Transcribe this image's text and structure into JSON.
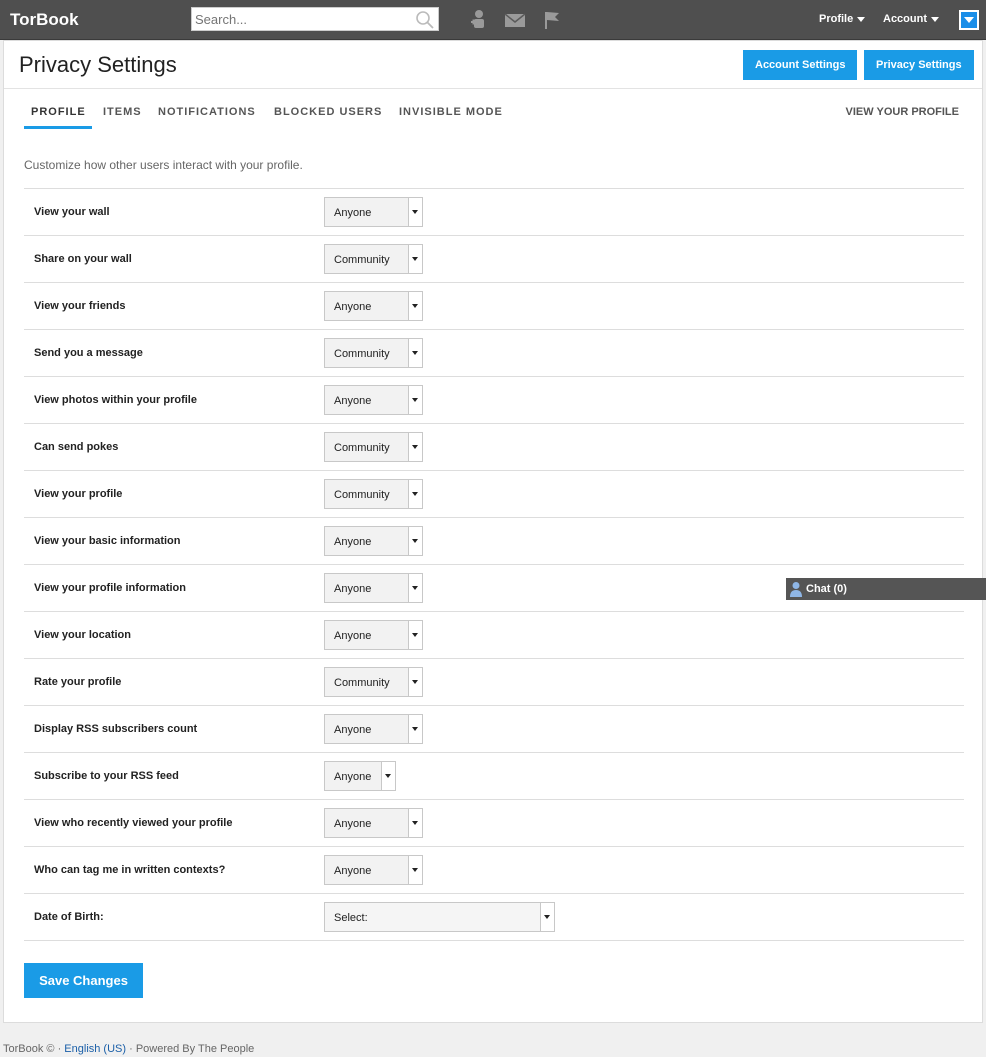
{
  "app": {
    "title": "TorBook"
  },
  "search": {
    "placeholder": "Search..."
  },
  "topnav": {
    "icons": [
      "friend-requests-icon",
      "messages-icon",
      "notifications-flag-icon"
    ],
    "profile_label": "Profile",
    "account_label": "Account"
  },
  "header": {
    "title": "Privacy Settings",
    "account_settings": "Account Settings",
    "privacy_settings": "Privacy Settings"
  },
  "tabs": [
    {
      "label": "PROFILE",
      "active": true
    },
    {
      "label": "ITEMS"
    },
    {
      "label": "NOTIFICATIONS"
    },
    {
      "label": "BLOCKED USERS"
    },
    {
      "label": "INVISIBLE MODE"
    }
  ],
  "view_profile": "VIEW YOUR PROFILE",
  "intro": "Customize how other users interact with your profile.",
  "settings": [
    {
      "label": "View your wall",
      "value": "Anyone"
    },
    {
      "label": "Share on your wall",
      "value": "Community"
    },
    {
      "label": "View your friends",
      "value": "Anyone"
    },
    {
      "label": "Send you a message",
      "value": "Community"
    },
    {
      "label": "View photos within your profile",
      "value": "Anyone"
    },
    {
      "label": "Can send pokes",
      "value": "Community"
    },
    {
      "label": "View your profile",
      "value": "Community"
    },
    {
      "label": "View your basic information",
      "value": "Anyone"
    },
    {
      "label": "View your profile information",
      "value": "Anyone"
    },
    {
      "label": "View your location",
      "value": "Anyone"
    },
    {
      "label": "Rate your profile",
      "value": "Community"
    },
    {
      "label": "Display RSS subscribers count",
      "value": "Anyone"
    },
    {
      "label": "Subscribe to your RSS feed",
      "value": "Anyone"
    },
    {
      "label": "View who recently viewed your profile",
      "value": "Anyone"
    },
    {
      "label": "Who can tag me in written contexts?",
      "value": "Anyone"
    },
    {
      "label": "Date of Birth:",
      "value": "Select:"
    }
  ],
  "save_label": "Save Changes",
  "chat": {
    "label": "Chat (0)"
  },
  "footer": {
    "prefix": "TorBook © ·",
    "language": "English (US)",
    "suffix": "· Powered By The People"
  },
  "colors": {
    "topbar": "#4f4f4f",
    "accent": "#1a9be6"
  }
}
